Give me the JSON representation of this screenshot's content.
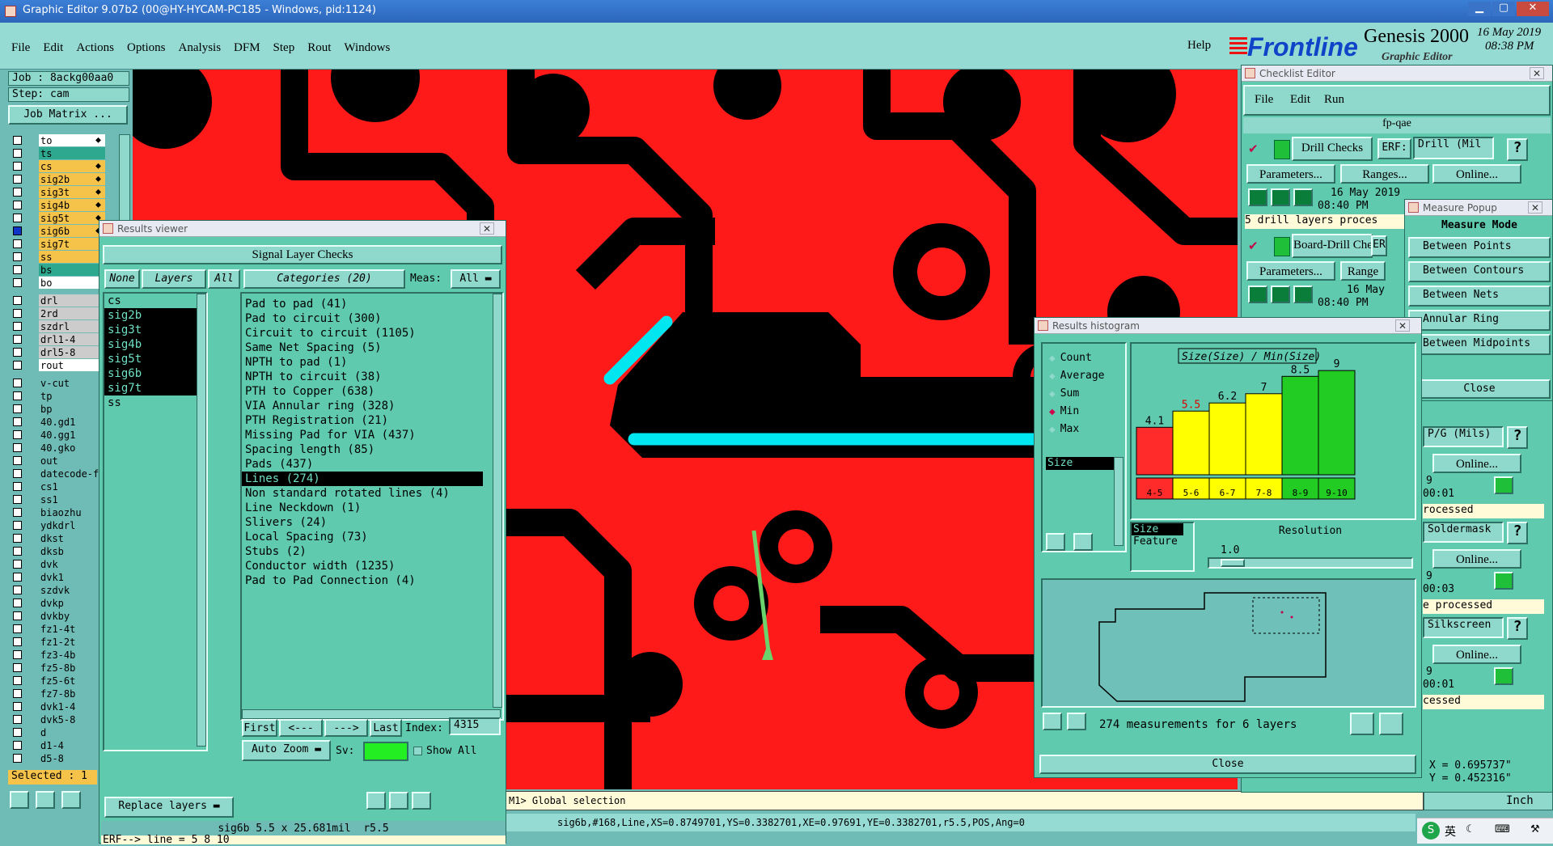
{
  "main_title": "Graphic Editor 9.07b2 (00@HY-HYCAM-PC185 - Windows, pid:1124)",
  "menu": [
    "File",
    "Edit",
    "Actions",
    "Options",
    "Analysis",
    "DFM",
    "Step",
    "Rout",
    "Windows"
  ],
  "help": "Help",
  "brand": {
    "logo": "Frontline",
    "product": "Genesis 2000",
    "sub": "Graphic Editor",
    "date": "16 May 2019",
    "time": "08:38 PM"
  },
  "job": {
    "job": "Job : 8ackg00aa0",
    "step": "Step: cam",
    "matrix": "Job Matrix ..."
  },
  "layers": [
    {
      "name": "to",
      "color": "#ffffff",
      "flag": true
    },
    {
      "name": "ts",
      "color": "#2ea88e",
      "flag": false
    },
    {
      "name": "cs",
      "color": "#f5c24a",
      "flag": true
    },
    {
      "name": "sig2b",
      "color": "#f5c24a",
      "flag": true
    },
    {
      "name": "sig3t",
      "color": "#f5c24a",
      "flag": true
    },
    {
      "name": "sig4b",
      "color": "#f5c24a",
      "flag": true
    },
    {
      "name": "sig5t",
      "color": "#f5c24a",
      "flag": true
    },
    {
      "name": "sig6b",
      "color": "#f5c24a",
      "flag": true
    },
    {
      "name": "sig7t",
      "color": "#f5c24a",
      "flag": false
    },
    {
      "name": "ss",
      "color": "#f5c24a",
      "flag": false
    },
    {
      "name": "bs",
      "color": "#2ea88e",
      "flag": false
    },
    {
      "name": "bo",
      "color": "#ffffff",
      "flag": false
    },
    {
      "name": "drl",
      "color": "#cccccc",
      "flag": false
    },
    {
      "name": "2rd",
      "color": "#cccccc",
      "flag": false
    },
    {
      "name": "szdrl",
      "color": "#cccccc",
      "flag": false
    },
    {
      "name": "drl1-4",
      "color": "#cccccc",
      "flag": false
    },
    {
      "name": "drl5-8",
      "color": "#cccccc",
      "flag": false
    },
    {
      "name": "rout",
      "color": "#ffffff",
      "flag": false
    },
    {
      "name": "v-cut",
      "color": "",
      "flag": false
    },
    {
      "name": "tp",
      "color": "",
      "flag": false
    },
    {
      "name": "bp",
      "color": "",
      "flag": false
    },
    {
      "name": "40.gd1",
      "color": "",
      "flag": false
    },
    {
      "name": "40.gg1",
      "color": "",
      "flag": false
    },
    {
      "name": "40.gko",
      "color": "",
      "flag": false
    },
    {
      "name": "out",
      "color": "",
      "flag": false
    },
    {
      "name": "datecode-f",
      "color": "",
      "flag": false
    },
    {
      "name": "cs1",
      "color": "",
      "flag": false
    },
    {
      "name": "ss1",
      "color": "",
      "flag": false
    },
    {
      "name": "biaozhu",
      "color": "",
      "flag": false
    },
    {
      "name": "ydkdrl",
      "color": "",
      "flag": false
    },
    {
      "name": "dkst",
      "color": "",
      "flag": false
    },
    {
      "name": "dksb",
      "color": "",
      "flag": false
    },
    {
      "name": "dvk",
      "color": "",
      "flag": false
    },
    {
      "name": "dvk1",
      "color": "",
      "flag": false
    },
    {
      "name": "szdvk",
      "color": "",
      "flag": false
    },
    {
      "name": "dvkp",
      "color": "",
      "flag": false
    },
    {
      "name": "dvkby",
      "color": "",
      "flag": false
    },
    {
      "name": "fz1-4t",
      "color": "",
      "flag": false
    },
    {
      "name": "fz1-2t",
      "color": "",
      "flag": false
    },
    {
      "name": "fz3-4b",
      "color": "",
      "flag": false
    },
    {
      "name": "fz5-8b",
      "color": "",
      "flag": false
    },
    {
      "name": "fz5-6t",
      "color": "",
      "flag": false
    },
    {
      "name": "fz7-8b",
      "color": "",
      "flag": false
    },
    {
      "name": "dvk1-4",
      "color": "",
      "flag": false
    },
    {
      "name": "dvk5-8",
      "color": "",
      "flag": false
    },
    {
      "name": "d",
      "color": "",
      "flag": false
    },
    {
      "name": "d1-4",
      "color": "",
      "flag": false
    },
    {
      "name": "d5-8",
      "color": "",
      "flag": false
    }
  ],
  "selected": "Selected : 1",
  "results_viewer": {
    "title": "Results viewer",
    "header": "Signal Layer Checks",
    "none": "None",
    "layers": "Layers",
    "all": "All",
    "categories_label": "Categories (20)",
    "meas_label": "Meas:",
    "meas_value": "All",
    "layer_list": [
      "cs",
      "sig2b",
      "sig3t",
      "sig4b",
      "sig5t",
      "sig6b",
      "sig7t",
      "ss"
    ],
    "categories": [
      "Pad to pad (41)",
      "Pad to circuit (300)",
      "Circuit to circuit (1105)",
      "Same Net Spacing (5)",
      "NPTH to pad (1)",
      "NPTH to circuit (38)",
      "PTH to Copper (638)",
      "VIA Annular ring (328)",
      "PTH Registration (21)",
      "Missing Pad for VIA (437)",
      "Spacing length (85)",
      "Pads (437)",
      "Lines (274)",
      "Non standard rotated lines (4)",
      "Line Neckdown (1)",
      "Slivers (24)",
      "Local Spacing (73)",
      "Stubs (2)",
      "Conductor width (1235)",
      "Pad to Pad Connection (4)"
    ],
    "first": "First",
    "prev": "<---",
    "next": "--->",
    "last": "Last",
    "index_label": "Index:",
    "index_value": "4315",
    "auto_zoom": "Auto Zoom",
    "sv": "Sv:",
    "show_all": "Show All",
    "replace": "Replace layers",
    "status": "sig6b 5.5 x 25.681mil  r5.5",
    "erf": "ERF--> line = 5 8 10",
    "close": "Close"
  },
  "checklist": {
    "title": "Checklist Editor",
    "menu": [
      "File",
      "Edit",
      "Run"
    ],
    "name": "fp-qae",
    "drill": {
      "label": "Drill Checks",
      "erf": "ERF:",
      "erf_value": "Drill (Mil",
      "params": "Parameters...",
      "ranges": "Ranges...",
      "online": "Online...",
      "date": "16 May 2019",
      "time": "08:40 PM",
      "status": "5 drill layers proces"
    },
    "board": {
      "label": "Board-Drill Che",
      "erf": "ER",
      "params": "Parameters...",
      "ranges": "Range",
      "date": "16 May",
      "time": "08:40 PM"
    },
    "r1": {
      "erf": "P/G (Mils)",
      "online": "Online...",
      "date": "9",
      "time": "00:01",
      "status": "rocessed"
    },
    "r2": {
      "erf": "Soldermask",
      "online": "Online...",
      "date": "9",
      "time": "00:03",
      "status": "e processed"
    },
    "r3": {
      "erf": "Silkscreen",
      "online": "Online...",
      "date": "9",
      "time": "00:01",
      "status": "cessed"
    },
    "coord_x": "X = 0.695737\"",
    "coord_y": "Y = 0.452316\"",
    "units": "Inch"
  },
  "measure": {
    "title": "Measure Popup",
    "mode": "Measure Mode",
    "items": [
      "Between Points",
      "Between Contours",
      "Between Nets",
      "Annular Ring",
      "Between Midpoints"
    ],
    "close": "Close"
  },
  "histogram": {
    "title": "Results histogram",
    "options": [
      "Count",
      "Average",
      "Sum",
      "Min",
      "Max"
    ],
    "selected_option": "Min",
    "attr_list": [
      "Size"
    ],
    "chart_title": "Size(Size) / Min(Size)",
    "sizes": [
      "Size",
      "Feature"
    ],
    "resolution_label": "Resolution",
    "resolution_value": "1.0",
    "footer": "274 measurements for 6 layers",
    "close": "Close"
  },
  "chart_data": {
    "type": "bar",
    "title": "Size(Size) / Min(Size)",
    "categories": [
      "4-5",
      "5-6",
      "6-7",
      "7-8",
      "8-9",
      "9-10"
    ],
    "values": [
      4.1,
      5.5,
      6.2,
      7,
      8.5,
      9
    ],
    "ylim": [
      0,
      9.5
    ],
    "colors": [
      "#ff2a2a",
      "#ffff00",
      "#ffff00",
      "#ffff00",
      "#22cc22",
      "#22cc22"
    ]
  },
  "command_line": "M1> Global selection",
  "status_bar": "sig6b,#168,Line,XS=0.8749701,YS=0.3382701,XE=0.97691,YE=0.3382701,r5.5,POS,Ang=0",
  "tray": "英",
  "colors": {
    "copper": "#ff1a1a",
    "substrate": "#000000",
    "highlight": "#00e6f0",
    "panel": "#5fcaae"
  }
}
